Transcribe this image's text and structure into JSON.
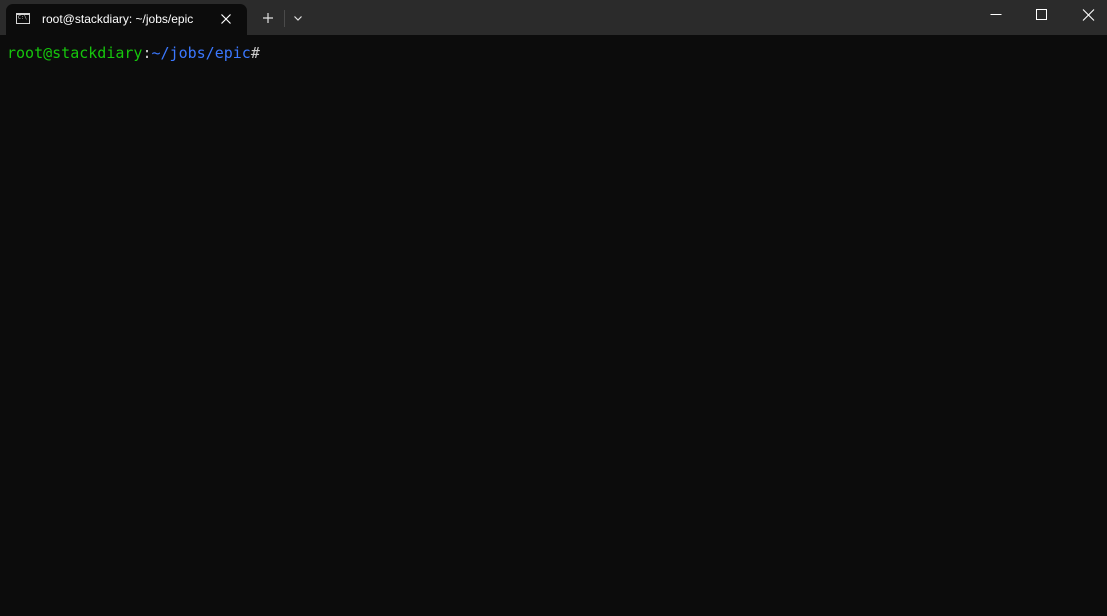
{
  "window": {
    "tab_title": "root@stackdiary: ~/jobs/epic",
    "tab_icon": "terminal-icon"
  },
  "titlebar": {
    "new_tab_icon": "plus-icon",
    "dropdown_icon": "chevron-down-icon",
    "minimize_icon": "minimize-icon",
    "maximize_icon": "maximize-icon",
    "close_icon": "close-icon"
  },
  "terminal": {
    "user_host": "root@stackdiary",
    "separator": ":",
    "path": "~/jobs/epic",
    "prompt_char": "#"
  },
  "colors": {
    "background": "#0c0c0c",
    "titlebar": "#2b2b2b",
    "user_host": "#16c60c",
    "path": "#3b78ff",
    "text": "#cccccc"
  }
}
